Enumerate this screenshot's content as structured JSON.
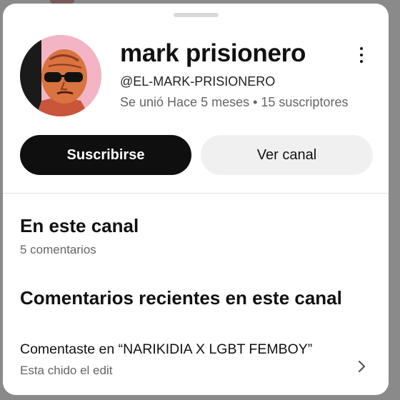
{
  "channel": {
    "name": "mark prisionero",
    "handle": "@EL-MARK-PRISIONERO",
    "meta": "Se unió Hace 5 meses • 15 suscriptores",
    "avatar_icon": "avatar-bald-man-sunglasses"
  },
  "menu": {
    "icon": "more-vertical-icon"
  },
  "actions": {
    "subscribe_label": "Suscribirse",
    "view_channel_label": "Ver canal"
  },
  "on_channel": {
    "title": "En este canal",
    "count_text": "5 comentarios"
  },
  "recent_comments": {
    "title": "Comentarios recientes en este canal",
    "items": [
      {
        "title": "Comentaste en “NARIKIDIA X LGBT FEMBOY”",
        "text": "Esta chido el edit",
        "icon": "chevron-right-icon"
      }
    ]
  },
  "colors": {
    "subscribe_bg": "#0f0f0f",
    "view_bg": "#f0f0f0",
    "avatar_bg": "#f3b4c6"
  }
}
